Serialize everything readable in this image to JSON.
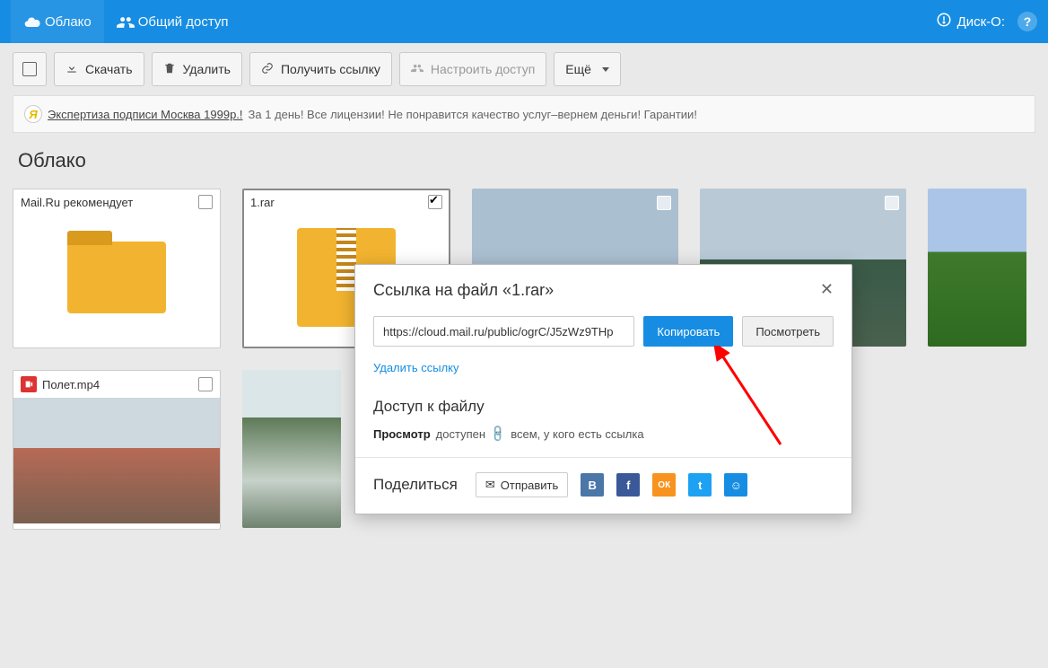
{
  "topbar": {
    "tab_cloud": "Облако",
    "tab_shared": "Общий доступ",
    "disk_label": "Диск-О:",
    "help": "?"
  },
  "toolbar": {
    "download": "Скачать",
    "delete": "Удалить",
    "get_link": "Получить ссылку",
    "configure_access": "Настроить доступ",
    "more": "Ещё"
  },
  "ad": {
    "link": "Экспертиза подписи Москва 1999р.!",
    "text": "За 1 день! Все лицензии! Не понравится качество услуг–вернем деньги! Гарантии!"
  },
  "page_title": "Облако",
  "files": {
    "recommend": {
      "name": "Mail.Ru рекомендует"
    },
    "rar": {
      "name": "1.rar"
    },
    "video": {
      "name": "Полет.mp4"
    }
  },
  "modal": {
    "title": "Ссылка на файл «1.rar»",
    "url": "https://cloud.mail.ru/public/ogrC/J5zWz9THp",
    "copy": "Копировать",
    "view": "Посмотреть",
    "delete_link": "Удалить ссылку",
    "access_title": "Доступ к файлу",
    "access_view": "Просмотр",
    "access_available": "доступен",
    "access_who": "всем, у кого есть ссылка",
    "share_title": "Поделиться",
    "send": "Отправить"
  },
  "social": {
    "vk": "B",
    "fb": "f",
    "ok": "ОК",
    "tw": "t",
    "mm": "☺"
  }
}
